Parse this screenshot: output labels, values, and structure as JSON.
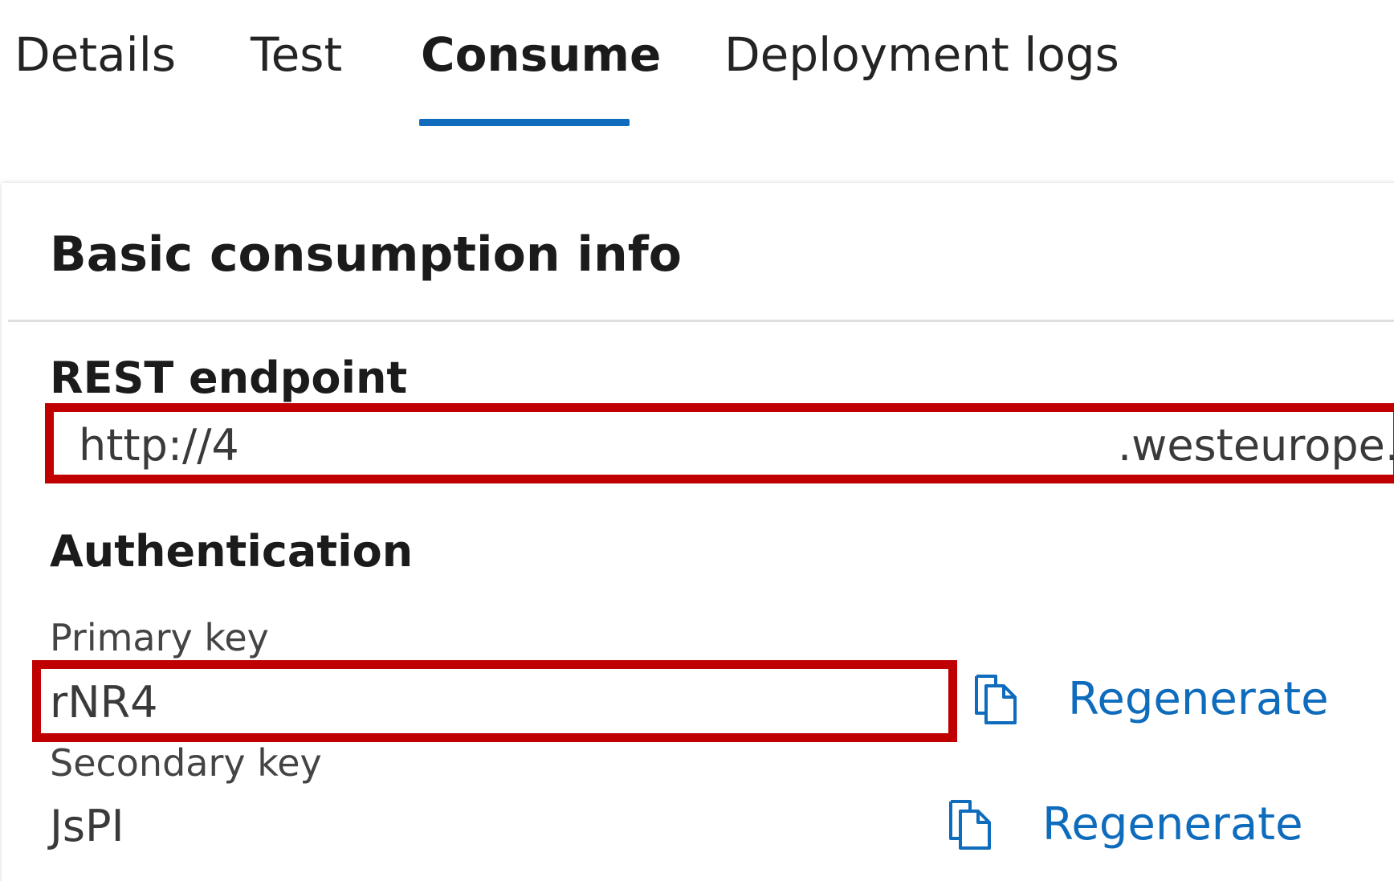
{
  "tabs": [
    {
      "label": "Details",
      "active": false
    },
    {
      "label": "Test",
      "active": false
    },
    {
      "label": "Consume",
      "active": true
    },
    {
      "label": "Deployment logs",
      "active": false
    }
  ],
  "card": {
    "title": "Basic consumption info",
    "rest_endpoint": {
      "label": "REST endpoint",
      "value_start": "http://4",
      "value_end": ".westeurope."
    },
    "authentication": {
      "label": "Authentication",
      "primary_key": {
        "label": "Primary key",
        "value": "rNR4",
        "regenerate_label": "Regenerate"
      },
      "secondary_key": {
        "label": "Secondary key",
        "value": "JsPI",
        "regenerate_label": "Regenerate"
      }
    }
  },
  "colors": {
    "accent": "#0f6cbd",
    "highlight": "#c00000",
    "divider": "#e1dfdd"
  },
  "icons": [
    "copy-icon"
  ]
}
